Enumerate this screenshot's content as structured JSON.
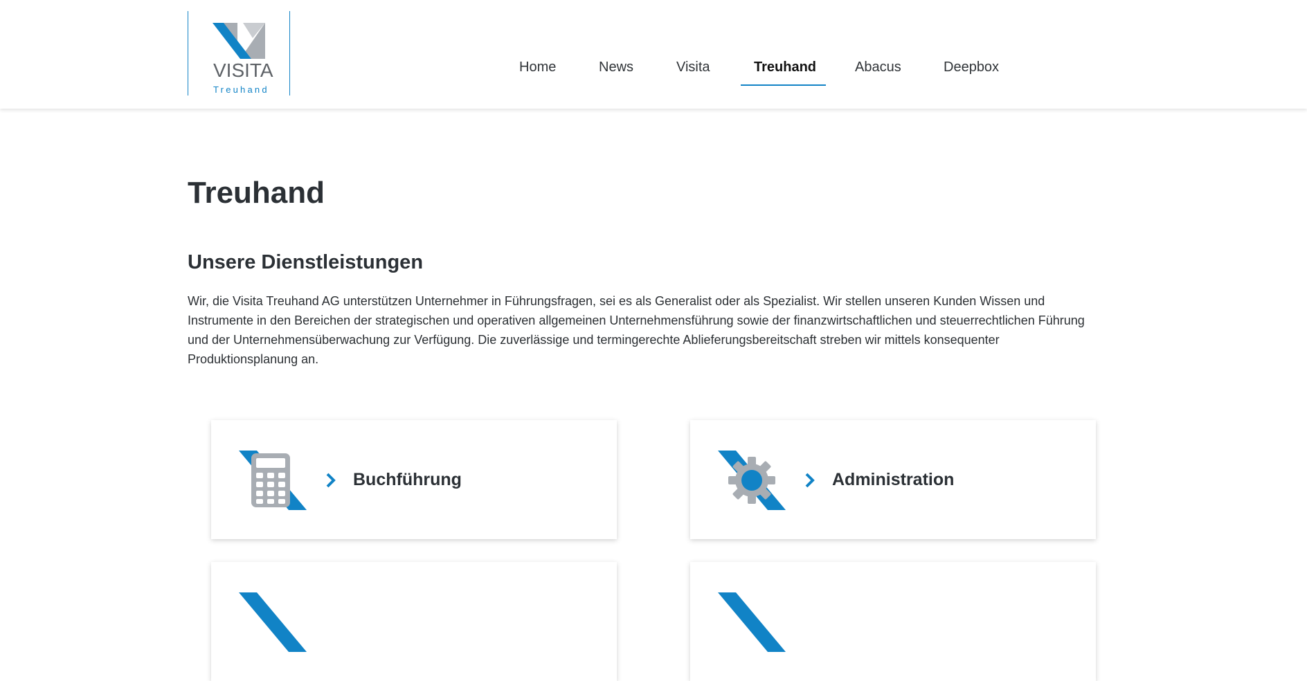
{
  "brand": {
    "word": "VISITA",
    "sub": "Treuhand"
  },
  "nav": {
    "items": [
      {
        "label": "Home"
      },
      {
        "label": "News"
      },
      {
        "label": "Visita"
      },
      {
        "label": "Treuhand",
        "active": true
      },
      {
        "label": "Abacus"
      },
      {
        "label": "Deepbox"
      }
    ]
  },
  "page": {
    "title": "Treuhand",
    "section_title": "Unsere Dienstleistungen",
    "intro": "Wir, die Visita Treuhand AG unterstützen Unternehmer in Führungsfragen, sei es als Generalist oder als Spezialist. Wir stellen unseren Kunden Wissen und Instrumente in den Bereichen der strategischen und operativen allgemeinen Unternehmensführung sowie der finanzwirtschaftlichen und steuerrechtlichen Führung und der Unternehmensüberwachung zur Verfügung. Die zuverlässige und termingerechte Ablieferungsbereitschaft streben wir mittels konsequenter Produktionsplanung an."
  },
  "services": [
    {
      "label": "Buchführung",
      "icon": "calculator-icon"
    },
    {
      "label": "Administration",
      "icon": "gear-icon"
    },
    {
      "label": "",
      "icon": "service-icon"
    },
    {
      "label": "",
      "icon": "service-icon"
    }
  ],
  "colors": {
    "accent": "#1183c6",
    "gray": "#a8adb3",
    "text": "#2b3035"
  }
}
